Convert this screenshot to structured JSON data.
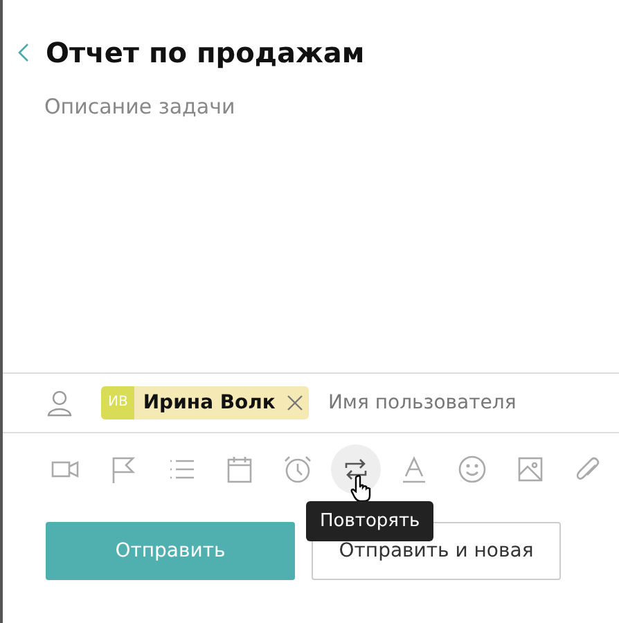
{
  "title": "Отчет по продажам",
  "description": {
    "placeholder": "Описание задачи"
  },
  "assignee": {
    "initials": "ИВ",
    "name": "Ирина Волк",
    "placeholder": "Имя пользователя"
  },
  "toolbar": [
    {
      "kind": "video",
      "hovered": false
    },
    {
      "kind": "flag",
      "hovered": false
    },
    {
      "kind": "list",
      "hovered": false
    },
    {
      "kind": "calendar",
      "hovered": false
    },
    {
      "kind": "alarm",
      "hovered": false
    },
    {
      "kind": "repeat",
      "hovered": true,
      "tooltip": "Повторять"
    },
    {
      "kind": "text",
      "hovered": false
    },
    {
      "kind": "emoji",
      "hovered": false
    },
    {
      "kind": "image",
      "hovered": false
    },
    {
      "kind": "attach",
      "hovered": false
    }
  ],
  "buttons": [
    {
      "label": "Отправить",
      "kind": "primary"
    },
    {
      "label": "Отправить и новая",
      "kind": "secondary"
    }
  ]
}
